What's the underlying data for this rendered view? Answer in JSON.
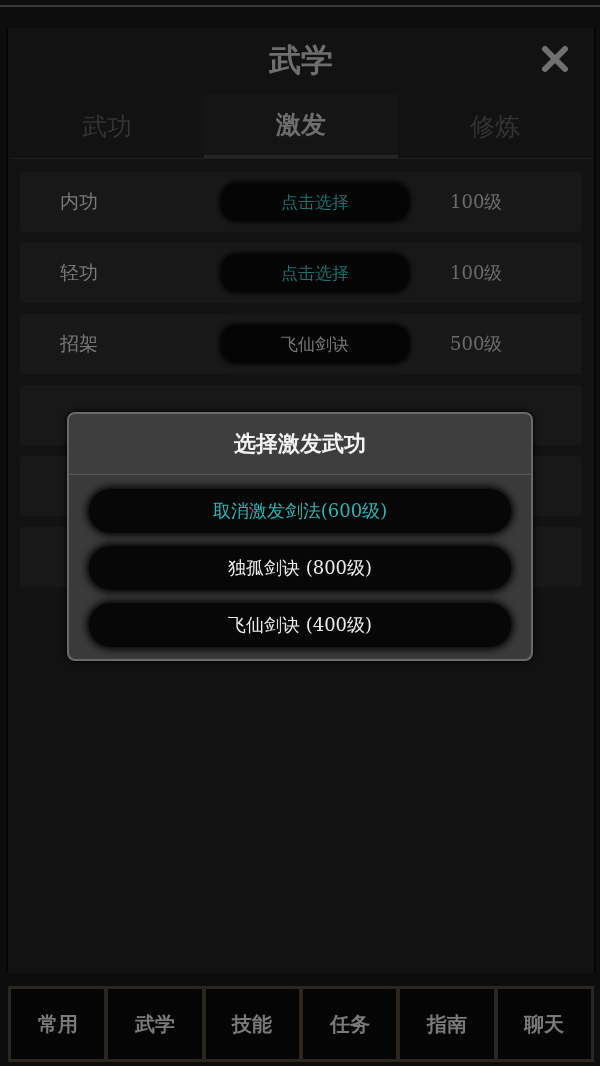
{
  "window": {
    "title": "武学"
  },
  "tabs": [
    {
      "label": "武功",
      "selected": false
    },
    {
      "label": "激发",
      "selected": true
    },
    {
      "label": "修炼",
      "selected": false
    }
  ],
  "rows": [
    {
      "name": "内功",
      "skill": {
        "kind": "prompt",
        "label": "点击选择"
      },
      "level": "100级"
    },
    {
      "name": "轻功",
      "skill": {
        "kind": "prompt",
        "label": "点击选择"
      },
      "level": "100级"
    },
    {
      "name": "招架",
      "skill": {
        "kind": "chosen",
        "label": "飞仙剑诀"
      },
      "level": "500级"
    },
    {},
    {},
    {}
  ],
  "dialog": {
    "title": "选择激发武功",
    "options": [
      {
        "kind": "cancel",
        "label": "取消激发剑法(600级)"
      },
      {
        "kind": "skill",
        "label": "独孤剑诀 (800级)"
      },
      {
        "kind": "skill",
        "label": "飞仙剑诀 (400级)"
      }
    ]
  },
  "bottom_nav": [
    "常用",
    "武学",
    "技能",
    "任务",
    "指南",
    "聊天"
  ]
}
